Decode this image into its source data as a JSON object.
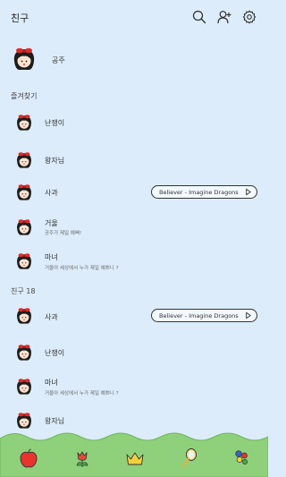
{
  "header": {
    "title": "친구",
    "icons": [
      "search-icon",
      "add-friend-icon",
      "settings-icon"
    ]
  },
  "me": {
    "name": "공주"
  },
  "favorites": {
    "label": "즐겨찾기",
    "items": [
      {
        "name": "난쟁이"
      },
      {
        "name": "왕자님"
      },
      {
        "name": "사과",
        "music": "Believer - Imagine Dragons"
      },
      {
        "name": "거울",
        "status": "공주가 제일 예뻐!"
      },
      {
        "name": "마녀",
        "status": "거울아 세상에서 누가 제일 예쁘니 ?"
      }
    ]
  },
  "friends": {
    "label": "친구 18",
    "items": [
      {
        "name": "사과",
        "music": "Believer - Imagine Dragons"
      },
      {
        "name": "난쟁이"
      },
      {
        "name": "마녀",
        "status": "거울아 세상에서 누가 제일 예쁘니 ?"
      },
      {
        "name": "왕자님"
      }
    ]
  },
  "tabbar": {
    "icons": [
      "apple-icon",
      "tulip-icon",
      "crown-icon",
      "mirror-icon",
      "flower-icon"
    ]
  },
  "colors": {
    "background": "#dcecfb",
    "ground": "#8fd07a",
    "ground_dark": "#6fb95c",
    "apple": "#e8332f"
  }
}
